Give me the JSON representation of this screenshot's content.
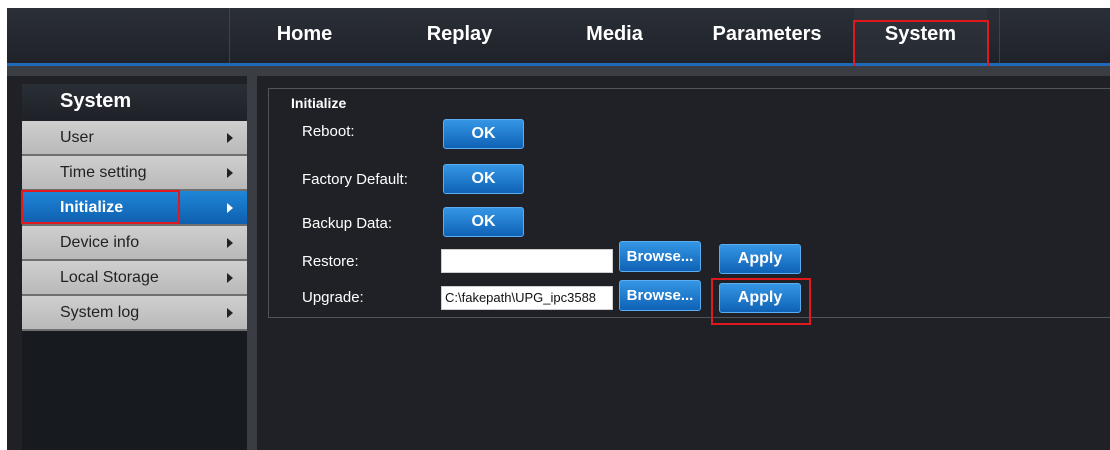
{
  "nav": {
    "tabs": [
      {
        "label": "Home"
      },
      {
        "label": "Replay"
      },
      {
        "label": "Media"
      },
      {
        "label": "Parameters"
      },
      {
        "label": "System",
        "active": true
      }
    ]
  },
  "sidebar": {
    "title": "System",
    "items": [
      {
        "label": "User"
      },
      {
        "label": "Time setting"
      },
      {
        "label": "Initialize",
        "active": true
      },
      {
        "label": "Device info"
      },
      {
        "label": "Local Storage"
      },
      {
        "label": "System log"
      }
    ]
  },
  "panel": {
    "title": "Initialize",
    "reboot": {
      "label": "Reboot:",
      "button": "OK"
    },
    "factory_default": {
      "label": "Factory Default:",
      "button": "OK"
    },
    "backup": {
      "label": "Backup Data:",
      "button": "OK"
    },
    "restore": {
      "label": "Restore:",
      "value": "",
      "browse": "Browse...",
      "apply": "Apply"
    },
    "upgrade": {
      "label": "Upgrade:",
      "value": "C:\\fakepath\\UPG_ipc3588",
      "browse": "Browse...",
      "apply": "Apply"
    }
  },
  "colors": {
    "accent": "#1f6ab8",
    "highlight": "#e0191f",
    "background": "#1f2127"
  },
  "icons": {
    "sidebar_arrow": "chevron-right-icon"
  }
}
